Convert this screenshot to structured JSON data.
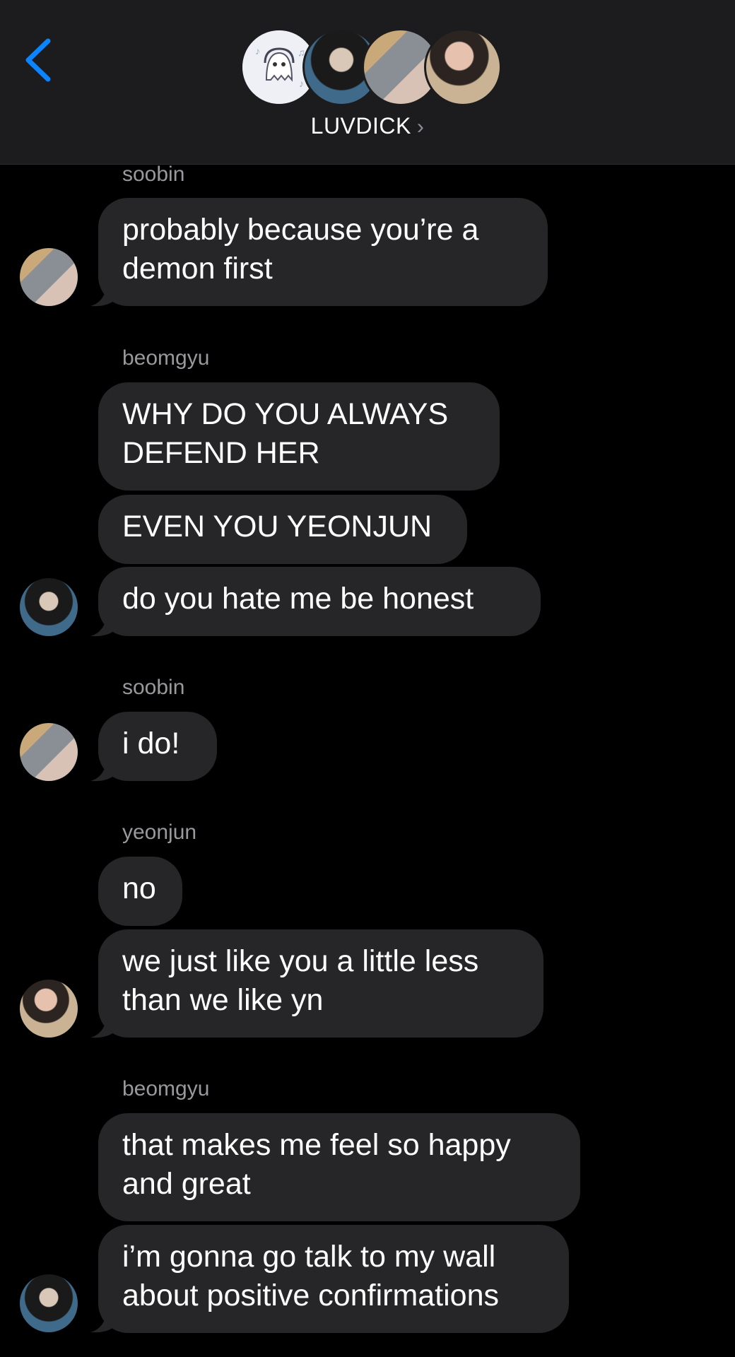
{
  "header": {
    "title": "LUVDICK",
    "chevron": "›",
    "back_icon": "chevron-left-icon",
    "accent": "#0a84ff"
  },
  "messages": [
    {
      "sender": "soobin",
      "texts": [
        "probably because you’re a demon first"
      ]
    },
    {
      "sender": "beomgyu",
      "texts": [
        "WHY DO YOU ALWAYS DEFEND HER",
        "EVEN YOU YEONJUN",
        "do you hate me be honest"
      ]
    },
    {
      "sender": "soobin",
      "texts": [
        "i do!"
      ]
    },
    {
      "sender": "yeonjun",
      "texts": [
        "no",
        "we just like you a little less than we like yn"
      ]
    },
    {
      "sender": "beomgyu",
      "texts": [
        "that makes me feel so happy and great",
        "i’m gonna go talk to my wall about positive confirmations"
      ]
    }
  ],
  "colors": {
    "header_bg": "#1c1c1e",
    "bubble_bg": "#262628",
    "sender_text": "#98989d"
  }
}
